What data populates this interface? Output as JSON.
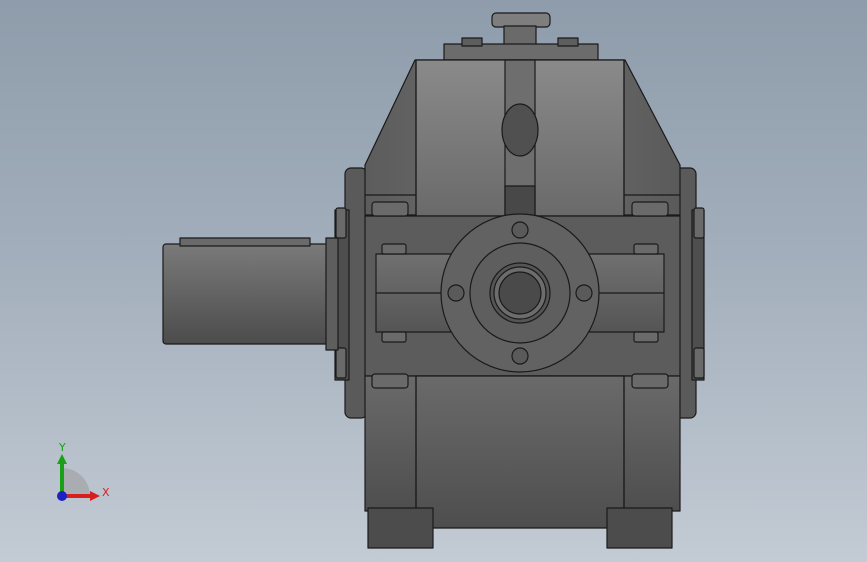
{
  "viewport": {
    "background_top": "#8e9cab",
    "background_bottom": "#c3cbd4",
    "model_shade_dark": "#4a4a4a",
    "model_shade_light": "#8a8a8a"
  },
  "triad": {
    "x_label": "X",
    "y_label": "Y",
    "x_color": "#d62020",
    "y_color": "#18a018",
    "z_color": "#2020c0"
  }
}
